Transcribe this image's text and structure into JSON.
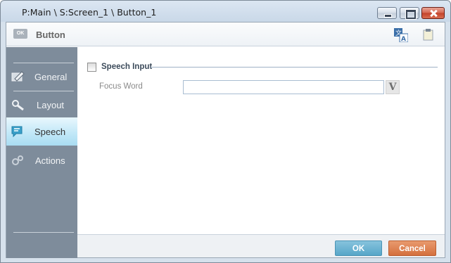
{
  "window": {
    "title": "P:Main \\ S:Screen_1 \\ Button_1"
  },
  "header": {
    "control_icon_text": "OK",
    "title": "Button",
    "icons": [
      "translate-icon",
      "clipboard-icon"
    ]
  },
  "sidebar": {
    "items": [
      {
        "label": "General",
        "icon": "general-icon",
        "active": false
      },
      {
        "label": "Layout",
        "icon": "layout-icon",
        "active": false
      },
      {
        "label": "Speech",
        "icon": "speech-icon",
        "active": true
      },
      {
        "label": "Actions",
        "icon": "actions-icon",
        "active": false
      }
    ]
  },
  "speech": {
    "checkbox_label": "Speech Input",
    "checked": false,
    "focus_word_label": "Focus Word",
    "focus_word_value": "",
    "variable_button_label": "V"
  },
  "footer": {
    "ok_label": "OK",
    "cancel_label": "Cancel"
  },
  "colors": {
    "sidebar": "#7e8c9b",
    "active_tab": "#bfe7f7",
    "ok": "#57a6c8",
    "cancel": "#d4703e"
  }
}
